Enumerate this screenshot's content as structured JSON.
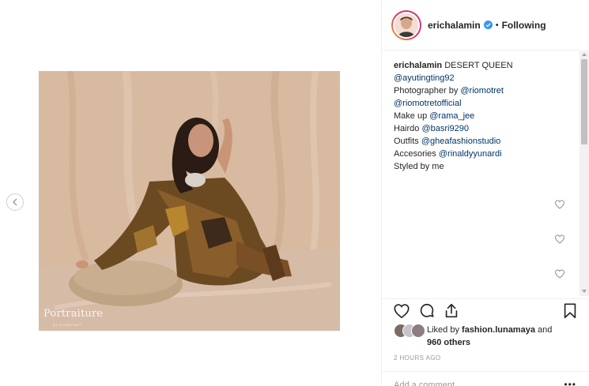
{
  "post": {
    "username": "erichalamin",
    "following_label": "Following",
    "dot": "•",
    "watermark": "Portraiture",
    "watermark_sub": "BY RIOMOTRET"
  },
  "caption": {
    "username": "erichalamin",
    "title": " DESERT QUEEN",
    "lines": [
      {
        "prefix": "",
        "mention": "@ayutingting92"
      },
      {
        "prefix": "Photographer by ",
        "mention": "@riomotret"
      },
      {
        "prefix": "",
        "mention": "@riomotretofficial"
      },
      {
        "prefix": "Make up ",
        "mention": "@rama_jee"
      },
      {
        "prefix": "Hairdo ",
        "mention": "@basri9290"
      },
      {
        "prefix": "Outfits ",
        "mention": "@gheafashionstudio"
      },
      {
        "prefix": "Accesories ",
        "mention": "@rinaldyyunardi"
      },
      {
        "prefix": "Styled by me",
        "mention": ""
      }
    ]
  },
  "likes": {
    "prefix": "Liked by ",
    "user": "fashion.lunamaya",
    "middle": " and",
    "count": "960 others"
  },
  "timestamp": "2 HOURS AGO",
  "comment_placeholder": "Add a comment...",
  "more_label": "•••",
  "colors": {
    "mention": "#003569",
    "text": "#262626",
    "muted": "#999999",
    "verified": "#3897f0"
  },
  "icons": [
    "chevron-left-icon",
    "verified-badge-icon",
    "heart-icon",
    "comment-icon",
    "share-icon",
    "bookmark-icon",
    "scrollbar-up-icon",
    "scrollbar-down-icon"
  ]
}
